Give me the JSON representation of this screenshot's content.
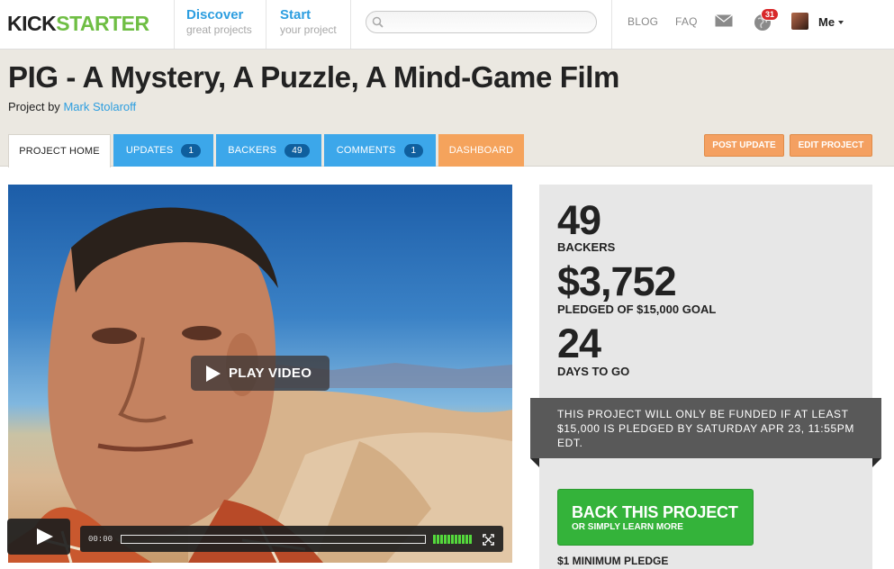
{
  "nav": {
    "logo_part1": "KICK",
    "logo_part2": "STARTER",
    "discover": {
      "title": "Discover",
      "subtitle": "great projects"
    },
    "start": {
      "title": "Start",
      "subtitle": "your project"
    },
    "search": {
      "value": "",
      "placeholder": ""
    },
    "blog": "BLOG",
    "faq": "FAQ",
    "notification_count": "31",
    "user_label": "Me",
    "icons": [
      "search-icon",
      "mail-icon",
      "globe-icon",
      "chevron-down-icon"
    ]
  },
  "project": {
    "title": "PIG - A Mystery, A Puzzle, A Mind-Game Film",
    "by_prefix": "Project by",
    "creator": "Mark Stolaroff"
  },
  "tabs": [
    {
      "label": "PROJECT HOME"
    },
    {
      "label": "UPDATES",
      "count": "1"
    },
    {
      "label": "BACKERS",
      "count": "49"
    },
    {
      "label": "COMMENTS",
      "count": "1"
    },
    {
      "label": "DASHBOARD"
    }
  ],
  "actions": {
    "post_update": "POST UPDATE",
    "edit_project": "EDIT PROJECT"
  },
  "video": {
    "play_label": "PLAY VIDEO",
    "time": "00:00",
    "progress": 0
  },
  "stats": {
    "backers_value": "49",
    "backers_label": "BACKERS",
    "pledged_value": "$3,752",
    "pledged_label": "PLEDGED OF $15,000 GOAL",
    "days_value": "24",
    "days_label": "DAYS TO GO"
  },
  "notice": "THIS PROJECT WILL ONLY BE FUNDED IF AT LEAST $15,000 IS PLEDGED BY SATURDAY APR 23, 11:55PM EDT.",
  "back": {
    "title": "BACK THIS PROJECT",
    "subtitle": "OR SIMPLY LEARN MORE",
    "min_pledge": "$1 MINIMUM PLEDGE"
  },
  "colors": {
    "accent_blue": "#3ca7ea",
    "accent_orange": "#f5a35c",
    "back_green": "#34b33a",
    "logo_green": "#6fbe44",
    "header_bg": "#ebe8e1"
  }
}
